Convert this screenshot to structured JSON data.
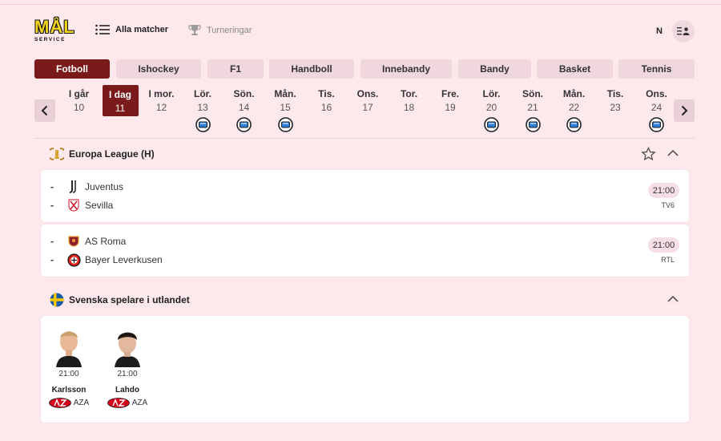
{
  "logo": {
    "main": "MÅL",
    "sub": "SERVICE"
  },
  "header": {
    "all_matches": "Alla matcher",
    "tournaments": "Turneringar",
    "lang": "N"
  },
  "sports": [
    "Fotboll",
    "Ishockey",
    "F1",
    "Handboll",
    "Innebandy",
    "Bandy",
    "Basket",
    "Tennis"
  ],
  "active_sport": "Fotboll",
  "dates": [
    {
      "day": "I går",
      "num": "10",
      "tv": false
    },
    {
      "day": "I dag",
      "num": "11",
      "tv": false,
      "active": true
    },
    {
      "day": "I mor.",
      "num": "12",
      "tv": false
    },
    {
      "day": "Lör.",
      "num": "13",
      "tv": true
    },
    {
      "day": "Sön.",
      "num": "14",
      "tv": true
    },
    {
      "day": "Mån.",
      "num": "15",
      "tv": true
    },
    {
      "day": "Tis.",
      "num": "16",
      "tv": false
    },
    {
      "day": "Ons.",
      "num": "17",
      "tv": false
    },
    {
      "day": "Tor.",
      "num": "18",
      "tv": false
    },
    {
      "day": "Fre.",
      "num": "19",
      "tv": false
    },
    {
      "day": "Lör.",
      "num": "20",
      "tv": true
    },
    {
      "day": "Sön.",
      "num": "21",
      "tv": true
    },
    {
      "day": "Mån.",
      "num": "22",
      "tv": true
    },
    {
      "day": "Tis.",
      "num": "23",
      "tv": false
    },
    {
      "day": "Ons.",
      "num": "24",
      "tv": true
    }
  ],
  "competition": {
    "name": "Europa League (H)",
    "matches": [
      {
        "home": "Juventus",
        "away": "Sevilla",
        "home_score": "-",
        "away_score": "-",
        "time": "21:00",
        "channel": "TV6"
      },
      {
        "home": "AS Roma",
        "away": "Bayer Leverkusen",
        "home_score": "-",
        "away_score": "-",
        "time": "21:00",
        "channel": "RTL"
      }
    ]
  },
  "swedes": {
    "title": "Svenska spelare i utlandet",
    "players": [
      {
        "name": "Karlsson",
        "time": "21:00",
        "club": "AZA"
      },
      {
        "name": "Lahdo",
        "time": "21:00",
        "club": "AZA"
      }
    ]
  },
  "colors": {
    "background": "#fde8ec",
    "accent": "#7a1a1a",
    "tab": "#f0d7dd",
    "card": "#ffffff"
  }
}
